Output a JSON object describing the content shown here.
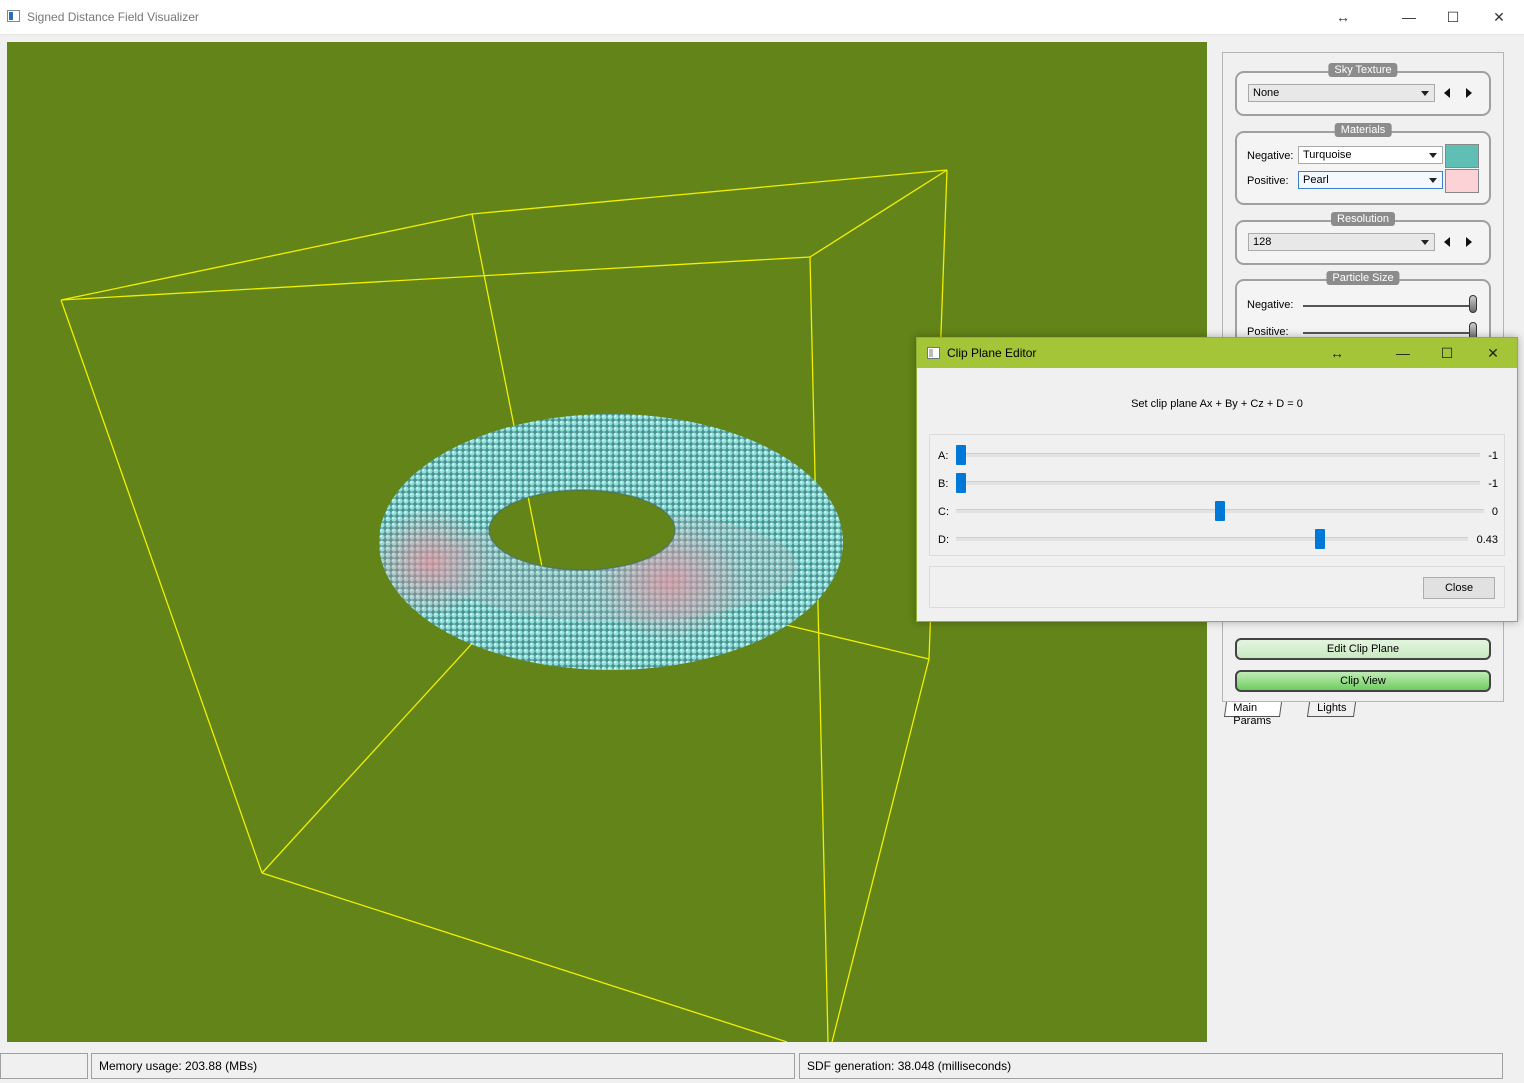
{
  "window": {
    "title": "Signed Distance Field Visualizer",
    "controls": {
      "resize": "↔",
      "minimize": "—",
      "maximize": "☐",
      "close": "✕"
    }
  },
  "colors": {
    "viewport_bg": "#638418",
    "wireframe": "#f0f000",
    "torus_main": "#7fd9d4",
    "torus_pink": "#e39ea8",
    "dialog_title_bg": "#a3c537",
    "negative_material": "#5fbfb4",
    "positive_material": "#fcd2d6"
  },
  "panel": {
    "sky_texture": {
      "title": "Sky Texture",
      "value": "None"
    },
    "materials": {
      "title": "Materials",
      "negative_label": "Negative:",
      "negative_value": "Turquoise",
      "positive_label": "Positive:",
      "positive_value": "Pearl"
    },
    "resolution": {
      "title": "Resolution",
      "value": "128"
    },
    "particle_size": {
      "title": "Particle Size",
      "negative_label": "Negative:",
      "positive_label": "Positive:"
    },
    "edit_clip_plane": "Edit Clip Plane",
    "clip_view": "Clip View",
    "tabs": [
      "Main Params",
      "Lights"
    ]
  },
  "dialog": {
    "title": "Clip Plane Editor",
    "equation": "Set clip plane Ax + By + Cz + D = 0",
    "sliders": [
      {
        "label": "A:",
        "value": "-1",
        "fraction": 0.0
      },
      {
        "label": "B:",
        "value": "-1",
        "fraction": 0.0
      },
      {
        "label": "C:",
        "value": "0",
        "fraction": 0.5
      },
      {
        "label": "D:",
        "value": "0.43",
        "fraction": 0.715
      }
    ],
    "close_label": "Close"
  },
  "status": {
    "memory": "Memory usage: 203.88 (MBs)",
    "sdf": "SDF generation: 38.048 (milliseconds)"
  }
}
